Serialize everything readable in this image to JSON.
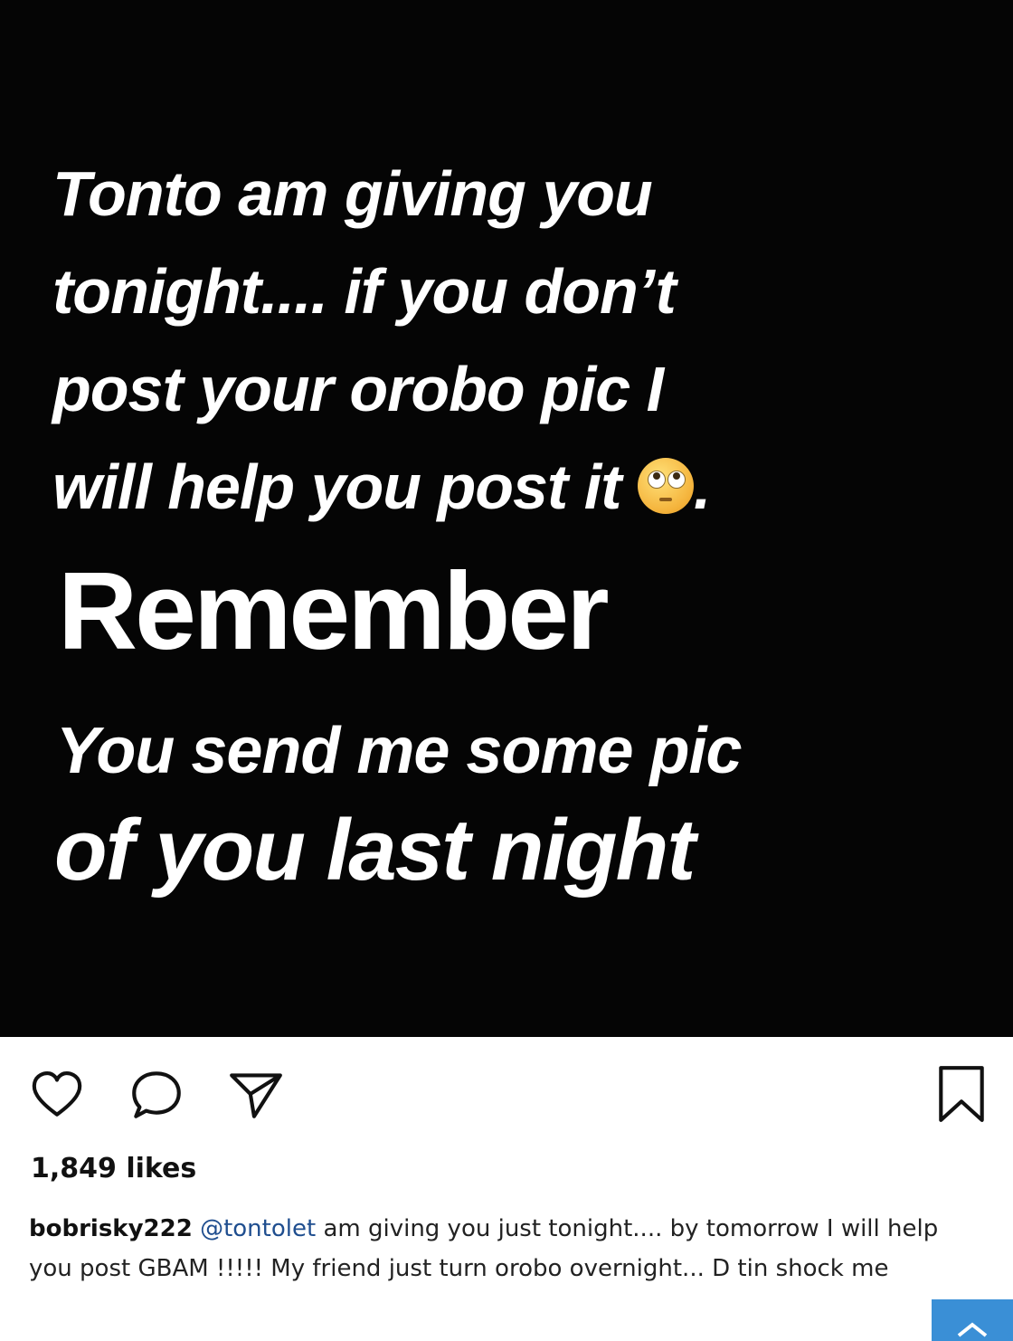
{
  "post": {
    "story_lines": [
      "Tonto am giving you",
      "tonight.... if you don’t",
      "post your orobo pic I",
      "will help you post it",
      "."
    ],
    "story_big": "Remember",
    "story_mid": "You send me some pic",
    "story_last": "of you last night",
    "emoji": "face-with-rolling-eyes-icon",
    "background_color": "#050505"
  },
  "actions": {
    "icons": [
      "heart-icon",
      "comment-icon",
      "share-icon",
      "bookmark-icon"
    ]
  },
  "likes": "1,849 likes",
  "caption": {
    "username": "bobrisky222",
    "mention": "@tontolet",
    "text": " am giving you just tonight.... by tomorrow I will help you post GBAM !!!!! My friend just turn orobo overnight... D tin shock me"
  },
  "colors": {
    "mention": "#1f4e8f",
    "badge": "#3a8fd6"
  }
}
